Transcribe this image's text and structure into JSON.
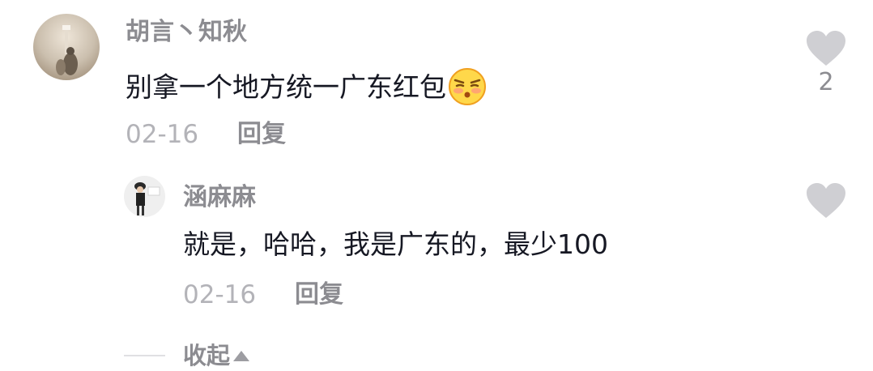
{
  "comment": {
    "username": "胡言丶知秋",
    "text": "别拿一个地方统一广东红包",
    "emoji": "smirk-blush-emoji",
    "date": "02-16",
    "reply_label": "回复",
    "like_count": "2",
    "avatar": "avatar-photo"
  },
  "reply": {
    "username": "涵麻麻",
    "text": "就是，哈哈，我是广东的，最少100",
    "date": "02-16",
    "reply_label": "回复",
    "avatar": "avatar-photo"
  },
  "collapse": {
    "label": "收起",
    "icon": "triangle-up-icon"
  },
  "colors": {
    "username": "#8c8c91",
    "text": "#161823",
    "date": "#b3b3b8",
    "heart": "#cfcfd3"
  }
}
